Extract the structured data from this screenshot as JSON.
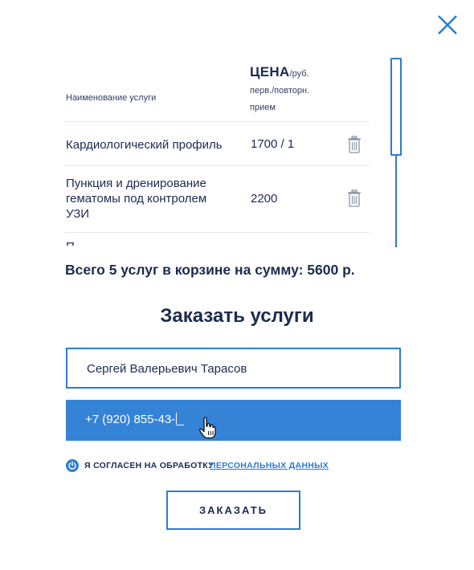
{
  "colors": {
    "accent": "#2e7bd2",
    "accent_fill": "#3483d7",
    "text": "#1d2b4f",
    "divider": "#e6e9ee"
  },
  "icons": {
    "close": "close-icon",
    "delete": "trash-icon",
    "consent": "power-icon",
    "pointer": "hand-cursor-icon"
  },
  "table": {
    "header_name": "Наименование услуги",
    "header_price_main": "ЦЕНА",
    "header_price_unit": "/руб.",
    "header_price_sub_line1": "перв./повторн.",
    "header_price_sub_line2": "прием",
    "rows": [
      {
        "name": "Кардиологический профиль",
        "price": "1700 / 1"
      },
      {
        "name": "Пункция и дренирование гематомы под контролем УЗИ",
        "price": "2200"
      },
      {
        "name": "П",
        "price": ""
      }
    ]
  },
  "summary": "Всего 5 услуг в корзине на сумму: 5600 р.",
  "order": {
    "title": "Заказать услуги",
    "name_value": "Сергей Валерьевич Тарасов",
    "phone_value": "+7 (920) 855-43-",
    "consent_text": "Я СОГЛАСЕН НА ОБРАБОТКУ",
    "consent_link": "ПЕРСОНАЛЬНЫХ ДАННЫХ",
    "submit_label": "ЗАКАЗАТЬ"
  }
}
